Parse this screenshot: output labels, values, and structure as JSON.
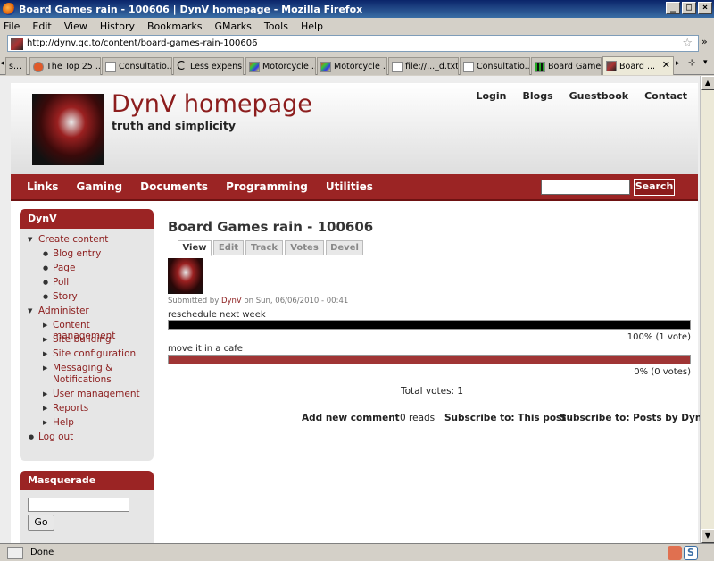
{
  "window": {
    "title": "Board Games rain - 100606 | DynV homepage - Mozilla Firefox"
  },
  "menubar": [
    "File",
    "Edit",
    "View",
    "History",
    "Bookmarks",
    "GMarks",
    "Tools",
    "Help"
  ],
  "address_bar": {
    "url": "http://dynv.qc.to/content/board-games-rain-100606"
  },
  "tabs": [
    {
      "label": "s..."
    },
    {
      "label": "The Top 25 ..."
    },
    {
      "label": "Consultatio..."
    },
    {
      "label": "Less expens..."
    },
    {
      "label": "Motorcycle ..."
    },
    {
      "label": "Motorcycle ..."
    },
    {
      "label": "file://..._d.txt"
    },
    {
      "label": "Consultatio..."
    },
    {
      "label": "Board Game..."
    },
    {
      "label": "Board ..."
    }
  ],
  "site": {
    "name": "DynV homepage",
    "slogan": "truth and simplicity",
    "secondary_links": [
      "Login",
      "Blogs",
      "Guestbook",
      "Contact"
    ],
    "primary_links": [
      "Links",
      "Gaming",
      "Documents",
      "Programming",
      "Utilities"
    ],
    "search_button": "Search"
  },
  "sidebar": {
    "nav_title": "DynV",
    "items": [
      {
        "label": "Create content",
        "level": 0
      },
      {
        "label": "Blog entry",
        "level": 1
      },
      {
        "label": "Page",
        "level": 1
      },
      {
        "label": "Poll",
        "level": 1
      },
      {
        "label": "Story",
        "level": 1
      },
      {
        "label": "Administer",
        "level": 0
      },
      {
        "label": "Content management",
        "level": 1
      },
      {
        "label": "Site building",
        "level": 1
      },
      {
        "label": "Site configuration",
        "level": 1
      },
      {
        "label": "Messaging &",
        "level": 1
      },
      {
        "label": "Notifications",
        "level": 1
      },
      {
        "label": "User management",
        "level": 1
      },
      {
        "label": "Reports",
        "level": 1
      },
      {
        "label": "Help",
        "level": 1
      },
      {
        "label": "Log out",
        "level": 0
      }
    ],
    "masquerade_title": "Masquerade",
    "go_button": "Go"
  },
  "main": {
    "title": "Board Games rain - 100606",
    "tabs": [
      "View",
      "Edit",
      "Track",
      "Votes",
      "Devel"
    ],
    "submitted_prefix": "Submitted by",
    "author": "DynV",
    "submitted_suffix": "on Sun, 06/06/2010 - 00:41",
    "poll": [
      {
        "label": "reschedule next week",
        "percent_text": "100% (1 vote)",
        "fraction": 1.0,
        "color": "#000000"
      },
      {
        "label": "move it in a cafe",
        "percent_text": "0% (0 votes)",
        "fraction": 1.0,
        "color": "#a03535"
      }
    ],
    "total_votes": "Total votes: 1",
    "links": {
      "add_comment": "Add new comment",
      "reads": "0 reads",
      "subscribe_post": "Subscribe to: This post",
      "subscribe_user": "Subscribe to: Posts by DynV"
    }
  },
  "statusbar": {
    "text": "Done"
  },
  "colors": {
    "brand": "#9b2424",
    "link": "#8c1d1d"
  }
}
